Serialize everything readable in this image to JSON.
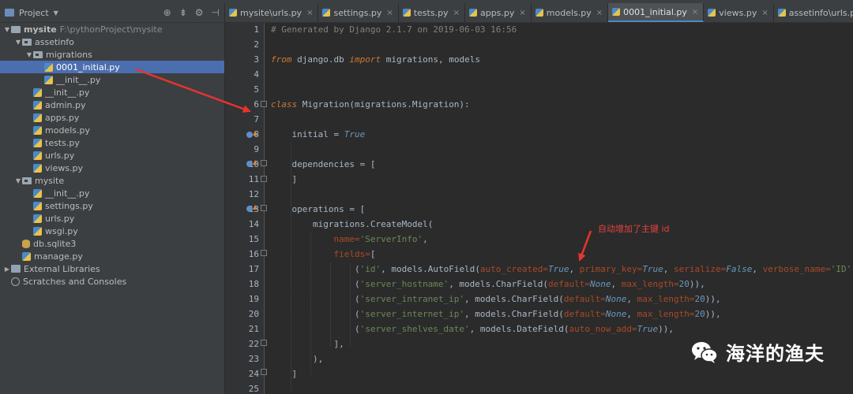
{
  "sidebar": {
    "header": {
      "title": "Project"
    },
    "tree": [
      {
        "label": "mysite",
        "suffix": "F:\\pythonProject\\mysite",
        "level": 0,
        "type": "root",
        "expanded": true
      },
      {
        "label": "assetinfo",
        "level": 1,
        "type": "package",
        "expanded": true
      },
      {
        "label": "migrations",
        "level": 2,
        "type": "package",
        "expanded": true
      },
      {
        "label": "0001_initial.py",
        "level": 3,
        "type": "py",
        "selected": true
      },
      {
        "label": "__init__.py",
        "level": 3,
        "type": "py"
      },
      {
        "label": "__init__.py",
        "level": 2,
        "type": "py"
      },
      {
        "label": "admin.py",
        "level": 2,
        "type": "py"
      },
      {
        "label": "apps.py",
        "level": 2,
        "type": "py"
      },
      {
        "label": "models.py",
        "level": 2,
        "type": "py"
      },
      {
        "label": "tests.py",
        "level": 2,
        "type": "py"
      },
      {
        "label": "urls.py",
        "level": 2,
        "type": "py"
      },
      {
        "label": "views.py",
        "level": 2,
        "type": "py"
      },
      {
        "label": "mysite",
        "level": 1,
        "type": "package",
        "expanded": true
      },
      {
        "label": "__init__.py",
        "level": 2,
        "type": "py"
      },
      {
        "label": "settings.py",
        "level": 2,
        "type": "py"
      },
      {
        "label": "urls.py",
        "level": 2,
        "type": "py"
      },
      {
        "label": "wsgi.py",
        "level": 2,
        "type": "py"
      },
      {
        "label": "db.sqlite3",
        "level": 1,
        "type": "db"
      },
      {
        "label": "manage.py",
        "level": 1,
        "type": "py"
      },
      {
        "label": "External Libraries",
        "level": 0,
        "type": "lib",
        "collapsed": true
      },
      {
        "label": "Scratches and Consoles",
        "level": 0,
        "type": "scratch"
      }
    ]
  },
  "tabs": [
    {
      "label": "mysite\\urls.py"
    },
    {
      "label": "settings.py"
    },
    {
      "label": "tests.py"
    },
    {
      "label": "apps.py"
    },
    {
      "label": "models.py"
    },
    {
      "label": "0001_initial.py",
      "active": true
    },
    {
      "label": "views.py"
    },
    {
      "label": "assetinfo\\urls.py"
    }
  ],
  "editor": {
    "line_numbers": [
      "1",
      "2",
      "3",
      "4",
      "5",
      "6",
      "7",
      "8",
      "9",
      "10",
      "11",
      "12",
      "13",
      "14",
      "15",
      "16",
      "17",
      "18",
      "19",
      "20",
      "21",
      "22",
      "23",
      "24",
      "25"
    ],
    "code": {
      "l1": "# Generated by Django 2.1.7 on 2019-06-03 16:56",
      "l3_from": "from",
      "l3_mod": " django.db ",
      "l3_import": "import",
      "l3_rest": " migrations, models",
      "l6_class": "class",
      "l6_name": " Migration",
      "l6_rest": "(migrations.Migration):",
      "l8_name": "    initial = ",
      "l8_val": "True",
      "l10": "    dependencies = [",
      "l11": "    ]",
      "l13": "    operations = [",
      "l14_a": "        migrations.",
      "l14_b": "CreateModel",
      "l14_c": "(",
      "l15_p": "            name=",
      "l15_s": "'ServerInfo'",
      "l15_e": ",",
      "l16_p": "            fields=",
      "l16_e": "[",
      "l17_a": "                (",
      "l17_s": "'id'",
      "l17_b": ", models.",
      "l17_f": "AutoField",
      "l17_c": "(",
      "l17_p1": "auto_created=",
      "l17_v1": "True",
      "l17_c1": ", ",
      "l17_p2": "primary_key=",
      "l17_v2": "True",
      "l17_c2": ", ",
      "l17_p3": "serialize=",
      "l17_v3": "False",
      "l17_c3": ", ",
      "l17_p4": "verbose_name=",
      "l17_s4": "'ID'",
      "l17_e": ")),",
      "l18_a": "                (",
      "l18_s": "'server_hostname'",
      "l18_b": ", models.",
      "l18_f": "CharField",
      "l18_c": "(",
      "l18_p1": "default=",
      "l18_v1": "None",
      "l18_c1": ", ",
      "l18_p2": "max_length=",
      "l18_n": "20",
      "l18_e": ")),",
      "l19_a": "                (",
      "l19_s": "'server_intranet_ip'",
      "l19_b": ", models.",
      "l19_f": "CharField",
      "l19_c": "(",
      "l19_p1": "default=",
      "l19_v1": "None",
      "l19_c1": ", ",
      "l19_p2": "max_length=",
      "l19_n": "20",
      "l19_e": ")),",
      "l20_a": "                (",
      "l20_s": "'server_internet_ip'",
      "l20_b": ", models.",
      "l20_f": "CharField",
      "l20_c": "(",
      "l20_p1": "default=",
      "l20_v1": "None",
      "l20_c1": ", ",
      "l20_p2": "max_length=",
      "l20_n": "20",
      "l20_e": ")),",
      "l21_a": "                (",
      "l21_s": "'server_shelves_date'",
      "l21_b": ", models.",
      "l21_f": "DateField",
      "l21_c": "(",
      "l21_p1": "auto_now_add=",
      "l21_v1": "True",
      "l21_e": ")),",
      "l22": "            ],",
      "l23": "        ),",
      "l24": "    ]"
    }
  },
  "annotation": {
    "text": "自动增加了主键 id",
    "color": "#e84040"
  },
  "watermark": {
    "text": "海洋的渔夫"
  },
  "colors": {
    "selection": "#4b6eaf",
    "keyword": "#cc7832",
    "string": "#6a8759",
    "constant": "#6897bb",
    "param": "#aa4926",
    "comment": "#808080"
  }
}
